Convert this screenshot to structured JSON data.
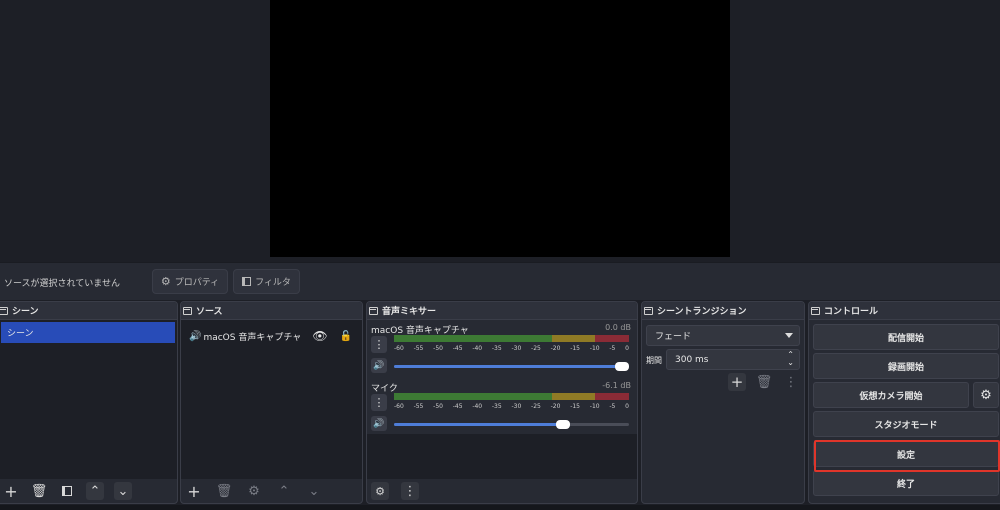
{
  "status_bar": {
    "message": "ソースが選択されていません",
    "properties_label": "プロパティ",
    "filters_label": "フィルタ"
  },
  "scenes": {
    "title": "シーン",
    "items": [
      "シーン"
    ]
  },
  "sources": {
    "title": "ソース",
    "items": [
      {
        "name": "macOS 音声キャプチャ",
        "visible": true,
        "locked": false
      }
    ]
  },
  "mixer": {
    "title": "音声ミキサー",
    "scale": [
      "-60",
      "-55",
      "-50",
      "-45",
      "-40",
      "-35",
      "-30",
      "-25",
      "-20",
      "-15",
      "-10",
      "-5",
      "0"
    ],
    "channels": [
      {
        "name": "macOS 音声キャプチャ",
        "db": "0.0 dB",
        "volume": 1.0
      },
      {
        "name": "マイク",
        "db": "-6.1 dB",
        "volume": 0.75
      }
    ]
  },
  "transitions": {
    "title": "シーントランジション",
    "selected": "フェード",
    "duration_label": "期間",
    "duration_value": "300 ms"
  },
  "controls": {
    "title": "コントロール",
    "start_streaming": "配信開始",
    "start_recording": "録画開始",
    "start_virtual_cam": "仮想カメラ開始",
    "studio_mode": "スタジオモード",
    "settings": "設定",
    "exit": "終了"
  },
  "colors": {
    "selection": "#284cb8",
    "highlight": "#e0352a",
    "meter_green": "#3d7a34",
    "meter_yellow": "#8f7a25",
    "meter_red": "#8a2b36"
  }
}
